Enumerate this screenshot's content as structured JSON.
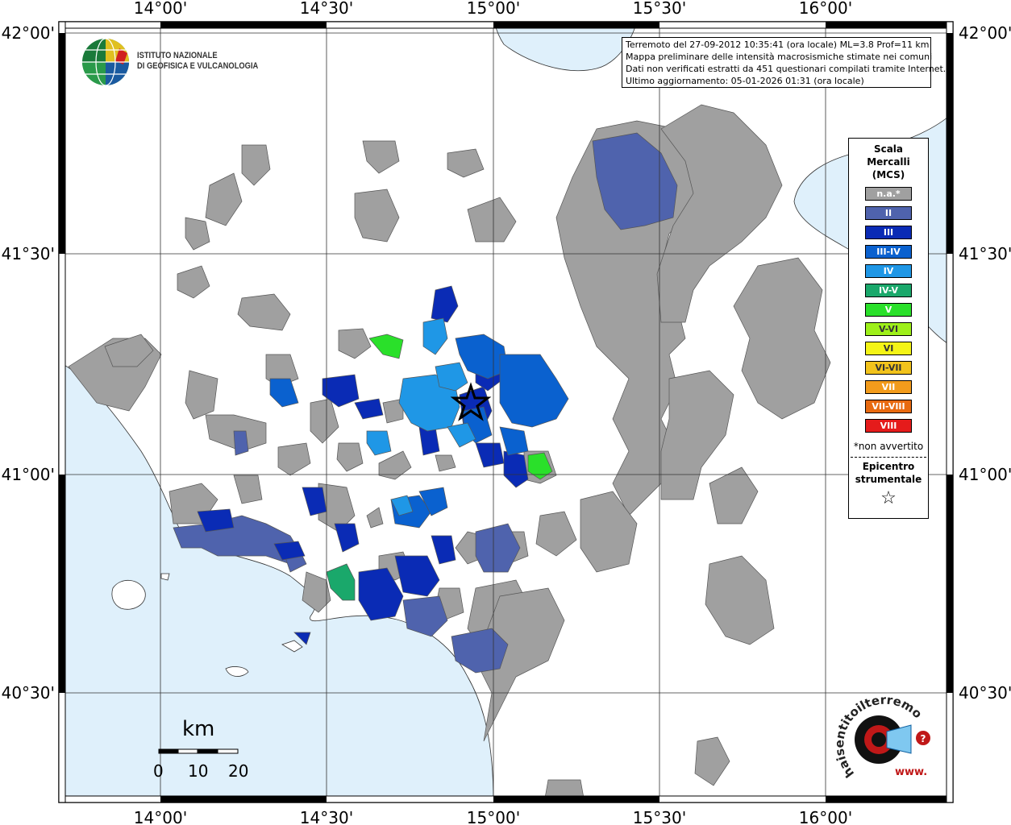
{
  "map": {
    "lon_labels_top": [
      "14°00'",
      "14°30'",
      "15°00'",
      "15°30'",
      "16°00'"
    ],
    "lon_labels_bottom": [
      "14°00'",
      "14°30'",
      "15°00'",
      "15°30'",
      "16°00'"
    ],
    "lat_labels_left": [
      "42°00'",
      "41°30'",
      "41°00'",
      "40°30'"
    ],
    "lat_labels_right": [
      "42°00'",
      "41°30'",
      "41°00'",
      "40°30'"
    ],
    "colors": {
      "sea": "#dff0fb",
      "land": "#ffffff",
      "not_felt": "#a0a0a0",
      "epicenter_star": "#000000"
    }
  },
  "logo": {
    "line1": "ISTITUTO NAZIONALE",
    "line2": "DI GEOFISICA E VULCANOLOGIA"
  },
  "info": {
    "line1": "Terremoto del 27-09-2012 10:35:41 (ora locale) ML=3.8 Prof=11 km",
    "line2": "Mappa preliminare delle intensità macrosismiche stimate nei comuni",
    "line3": "Dati non verificati estratti da 451 questionari compilati tramite Internet.",
    "line4": "Ultimo aggiornamento: 05-01-2026 01:31 (ora locale)"
  },
  "legend": {
    "title1": "Scala",
    "title2": "Mercalli",
    "title3": "(MCS)",
    "items": [
      {
        "label": "n.a.*",
        "color": "#a0a0a0"
      },
      {
        "label": "II",
        "color": "#4f63ad"
      },
      {
        "label": "III",
        "color": "#0a2bb5"
      },
      {
        "label": "III-IV",
        "color": "#0a61cf"
      },
      {
        "label": "IV",
        "color": "#1f97e6"
      },
      {
        "label": "IV-V",
        "color": "#1aa86b"
      },
      {
        "label": "V",
        "color": "#2ae02a"
      },
      {
        "label": "V-VI",
        "color": "#9ef01a"
      },
      {
        "label": "VI",
        "color": "#f4f416"
      },
      {
        "label": "VI-VII",
        "color": "#f2c31c"
      },
      {
        "label": "VII",
        "color": "#f29b1c"
      },
      {
        "label": "VII-VIII",
        "color": "#e86a10"
      },
      {
        "label": "VIII",
        "color": "#e51b1b"
      }
    ],
    "note": "*non avvertito",
    "epicenter1": "Epicentro",
    "epicenter2": "strumentale",
    "epicenter_symbol": "☆"
  },
  "scalebar": {
    "unit": "km",
    "ticks": [
      "0",
      "10",
      "20"
    ]
  },
  "brand": {
    "site": "haisentitoilterremoto.it",
    "www": "www."
  }
}
